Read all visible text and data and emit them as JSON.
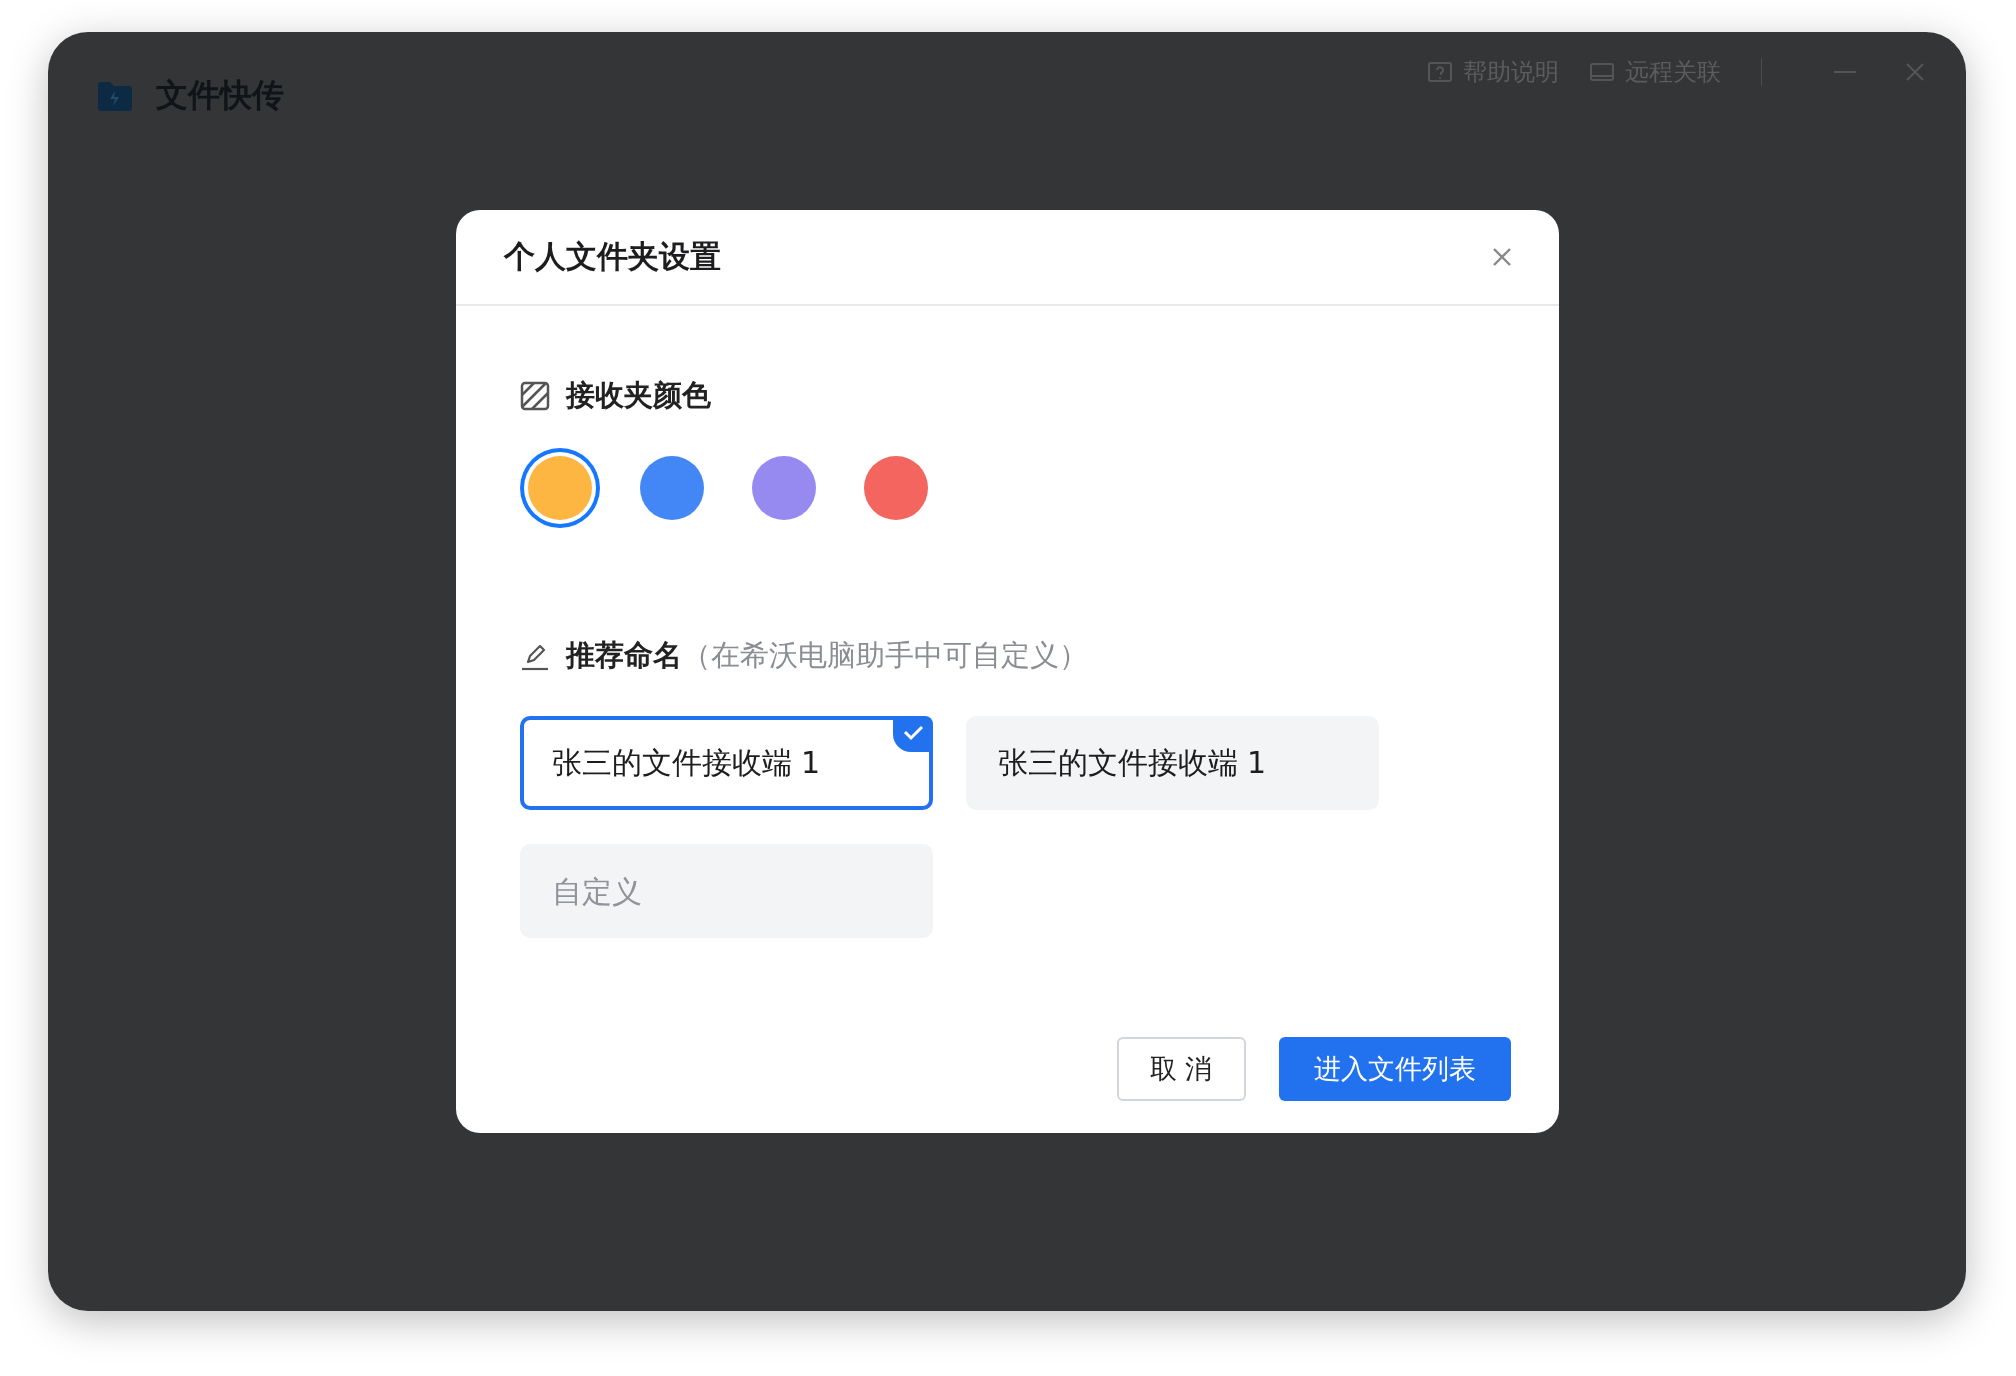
{
  "window": {
    "title": "文件快传",
    "header_actions": [
      {
        "label": "帮助说明",
        "kind": "help"
      },
      {
        "label": "远程关联",
        "kind": "remote"
      }
    ]
  },
  "dialog": {
    "title": "个人文件夹设置",
    "color_section": {
      "label": "接收夹颜色",
      "swatches": [
        {
          "color": "#fdb641",
          "selected": true
        },
        {
          "color": "#4287f5",
          "selected": false
        },
        {
          "color": "#9689f0",
          "selected": false
        },
        {
          "color": "#f46560",
          "selected": false
        }
      ]
    },
    "name_section": {
      "label": "推荐命名",
      "hint": "（在希沃电脑助手中可自定义）",
      "options": [
        {
          "text": "张三的文件接收端 1",
          "selected": true
        },
        {
          "text": "张三的文件接收端 1",
          "selected": false
        }
      ],
      "custom": {
        "placeholder": "自定义"
      }
    },
    "buttons": [
      {
        "label": "取 消",
        "kind": "secondary"
      },
      {
        "label": "进入文件列表",
        "kind": "primary"
      }
    ]
  }
}
